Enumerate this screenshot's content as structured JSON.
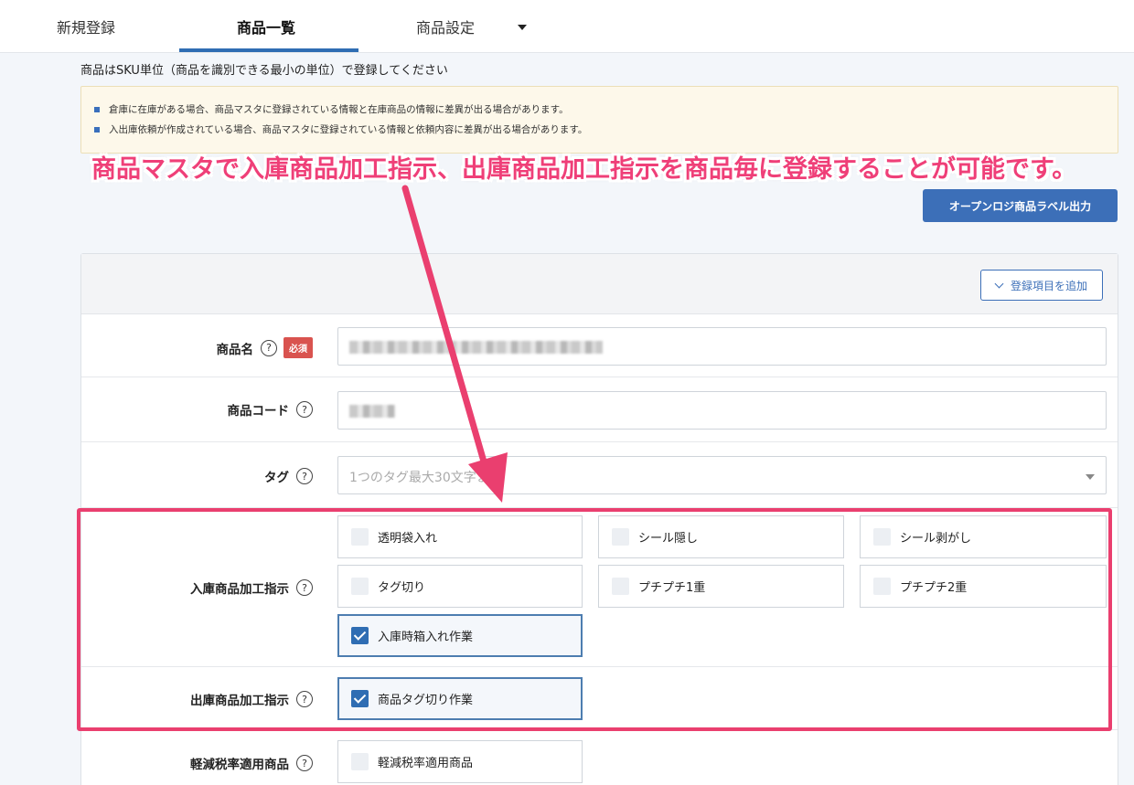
{
  "nav": {
    "tabs": [
      {
        "label": "新規登録"
      },
      {
        "label": "商品一覧"
      },
      {
        "label": "商品設定"
      }
    ]
  },
  "intro": "商品はSKU単位（商品を識別できる最小の単位）で登録してください",
  "notice": {
    "items": [
      "倉庫に在庫がある場合、商品マスタに登録されている情報と在庫商品の情報に差異が出る場合があります。",
      "入出庫依頼が作成されている場合、商品マスタに登録されている情報と依頼内容に差異が出る場合があります。"
    ]
  },
  "annotation": "商品マスタで入庫商品加工指示、出庫商品加工指示を商品毎に登録することが可能です。",
  "label_button": "オープンロジ商品ラベル出力",
  "add_fields_button": "登録項目を追加",
  "form": {
    "product_name": {
      "label": "商品名",
      "required": "必須"
    },
    "product_code": {
      "label": "商品コード"
    },
    "tag": {
      "label": "タグ",
      "placeholder": "1つのタグ最大30文字まで"
    },
    "inbound": {
      "label": "入庫商品加工指示",
      "options": [
        {
          "label": "透明袋入れ",
          "checked": false
        },
        {
          "label": "シール隠し",
          "checked": false
        },
        {
          "label": "シール剥がし",
          "checked": false
        },
        {
          "label": "タグ切り",
          "checked": false
        },
        {
          "label": "プチプチ1重",
          "checked": false
        },
        {
          "label": "プチプチ2重",
          "checked": false
        },
        {
          "label": "入庫時箱入れ作業",
          "checked": true
        }
      ]
    },
    "outbound": {
      "label": "出庫商品加工指示",
      "options": [
        {
          "label": "商品タグ切り作業",
          "checked": true
        }
      ]
    },
    "reduced_tax": {
      "label": "軽減税率適用商品",
      "options": [
        {
          "label": "軽減税率適用商品",
          "checked": false
        }
      ]
    }
  },
  "help_glyph": "?",
  "colors": {
    "accent": "#2f6db3",
    "annotation": "#ea3f6f",
    "required": "#d9534f"
  }
}
